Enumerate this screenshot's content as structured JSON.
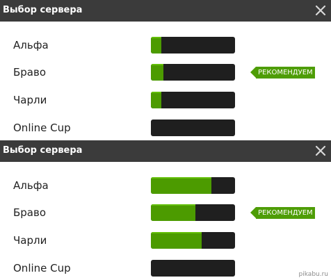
{
  "dialogs": [
    {
      "title": "Выбор сервера",
      "servers": [
        {
          "name": "Альфа",
          "load_fraction": 0.12
        },
        {
          "name": "Браво",
          "load_fraction": 0.15
        },
        {
          "name": "Чарли",
          "load_fraction": 0.12
        },
        {
          "name": "Online Cup",
          "load_fraction": 0.0
        }
      ]
    },
    {
      "title": "Выбор сервера",
      "servers": [
        {
          "name": "Альфа",
          "load_fraction": 0.72
        },
        {
          "name": "Браво",
          "load_fraction": 0.53
        },
        {
          "name": "Чарли",
          "load_fraction": 0.6
        },
        {
          "name": "Online Cup",
          "load_fraction": 0.0
        }
      ]
    }
  ],
  "recommended_badge": "РЕКОМЕНДУЕМ",
  "colors": {
    "titlebar": "#3b3b3b",
    "bar_background": "#1f1f1f",
    "bar_fill": "#4c9b00",
    "badge": "#4e9d06"
  },
  "icons": {
    "close": "close-icon"
  },
  "watermark": "pikabu.ru"
}
